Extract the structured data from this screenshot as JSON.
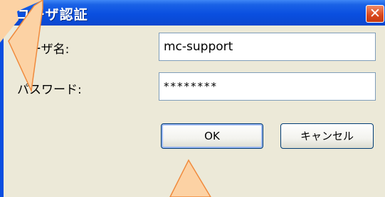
{
  "dialog": {
    "title": "ユーザ認証",
    "close_icon": "close-icon",
    "username_label": "ユーザ名:",
    "username_value": "mc-support",
    "password_label": "パスワード:",
    "password_value": "********",
    "ok_label": "OK",
    "cancel_label": "キャンセル"
  },
  "colors": {
    "titlebar": "#0a4fe0",
    "client_bg": "#ece9d8",
    "callout_fill": "#fcd2a4",
    "callout_stroke": "#f08a3c"
  }
}
